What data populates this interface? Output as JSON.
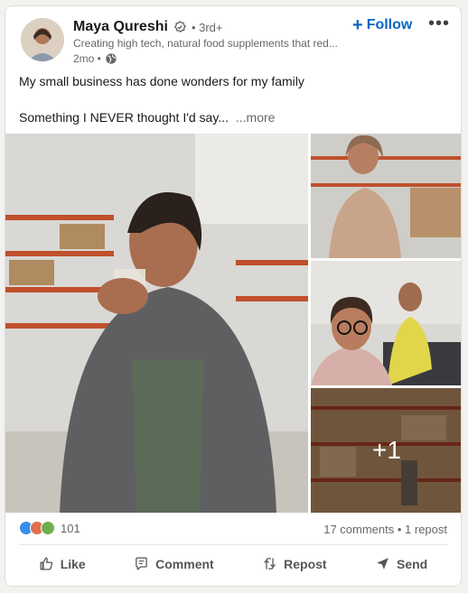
{
  "author": {
    "name": "Maya Qureshi",
    "degree": "• 3rd+",
    "headline": "Creating high tech, natural food supplements that red...",
    "time": "2mo •"
  },
  "follow_label": "Follow",
  "post": {
    "line1": "My small business has done wonders for my family",
    "line2": "Something I NEVER thought I'd say...",
    "see_more": "...more"
  },
  "media": {
    "extra_count": "+1"
  },
  "social": {
    "reaction_count": "101",
    "comments_repost": "17 comments • 1 repost"
  },
  "actions": {
    "like": "Like",
    "comment": "Comment",
    "repost": "Repost",
    "send": "Send"
  },
  "colors": {
    "accent": "#0a66c2",
    "like": "#378fe9",
    "celebrate": "#df704d",
    "love": "#df704d",
    "support": "#c37d16"
  }
}
